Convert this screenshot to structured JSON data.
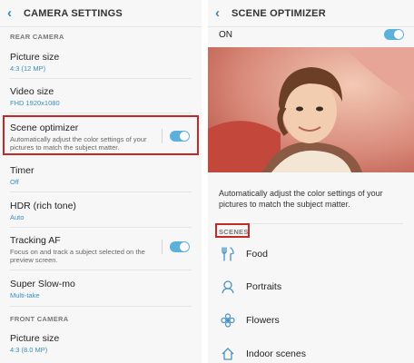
{
  "left": {
    "title": "CAMERA SETTINGS",
    "section_rear": "REAR CAMERA",
    "section_front": "FRONT CAMERA",
    "items": [
      {
        "label": "Picture size",
        "value": "4:3 (12 MP)"
      },
      {
        "label": "Video size",
        "value": "FHD 1920x1080"
      },
      {
        "label": "Scene optimizer",
        "desc": "Automatically adjust the color settings of your pictures to match the subject matter.",
        "enabled": true
      },
      {
        "label": "Timer",
        "value": "Off"
      },
      {
        "label": "HDR (rich tone)",
        "value": "Auto"
      },
      {
        "label": "Tracking AF",
        "desc": "Focus on and track a subject selected on the preview screen.",
        "enabled": true
      },
      {
        "label": "Super Slow-mo",
        "value": "Multi-take"
      },
      {
        "label": "Picture size",
        "value": "4:3 (8.0 MP)"
      }
    ]
  },
  "right": {
    "title": "SCENE OPTIMIZER",
    "master_label": "ON",
    "master_enabled": true,
    "description": "Automatically adjust the color settings of your pictures to match the subject matter.",
    "scenes_header": "SCENES",
    "scenes": [
      {
        "label": "Food",
        "icon": "utensils-icon"
      },
      {
        "label": "Portraits",
        "icon": "person-icon"
      },
      {
        "label": "Flowers",
        "icon": "flower-icon"
      },
      {
        "label": "Indoor scenes",
        "icon": "house-icon"
      }
    ]
  },
  "colors": {
    "accent": "#3a8fc0",
    "toggle_on": "#5db0d9",
    "highlight": "#c62828"
  }
}
